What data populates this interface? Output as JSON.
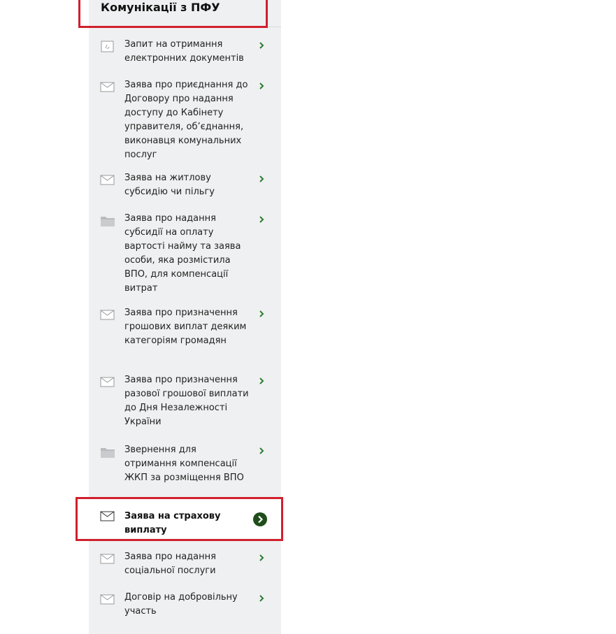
{
  "section": {
    "title": "Комунікації з ПФУ"
  },
  "colors": {
    "accent_green": "#2e7d32",
    "highlight_red": "#d0202e",
    "panel_bg": "#eff0f1"
  },
  "items": [
    {
      "label": "Запит на отримання електронних документів",
      "icon": "document-icon",
      "active": false
    },
    {
      "label": "Заява про приєднання до Договору про надання доступу до Кабінету управителя, об’єднання, виконавця комунальних послуг",
      "icon": "envelope-icon",
      "active": false
    },
    {
      "label": "Заява на житлову субсидію чи пільгу",
      "icon": "envelope-icon",
      "active": false
    },
    {
      "label": "Заява про надання субсидії на оплату вартості найму та заява особи, яка розмістила ВПО, для компенсації витрат",
      "icon": "folder-icon",
      "active": false
    },
    {
      "label": "Заява про призначення грошових виплат деяким категоріям громадян",
      "icon": "envelope-icon",
      "active": false
    },
    {
      "label": "Заява про призначення разової грошової виплати до Дня Незалежності України",
      "icon": "envelope-icon",
      "active": false
    },
    {
      "label": "Звернення для отримання компенсації ЖКП за розміщення ВПО",
      "icon": "folder-icon",
      "active": false
    },
    {
      "label": "Заява на страхову виплату",
      "icon": "envelope-icon",
      "active": true
    },
    {
      "label": "Заява про надання соціальної послуги",
      "icon": "envelope-icon",
      "active": false
    },
    {
      "label": "Договір на добровільну участь",
      "icon": "envelope-icon",
      "active": false
    }
  ]
}
